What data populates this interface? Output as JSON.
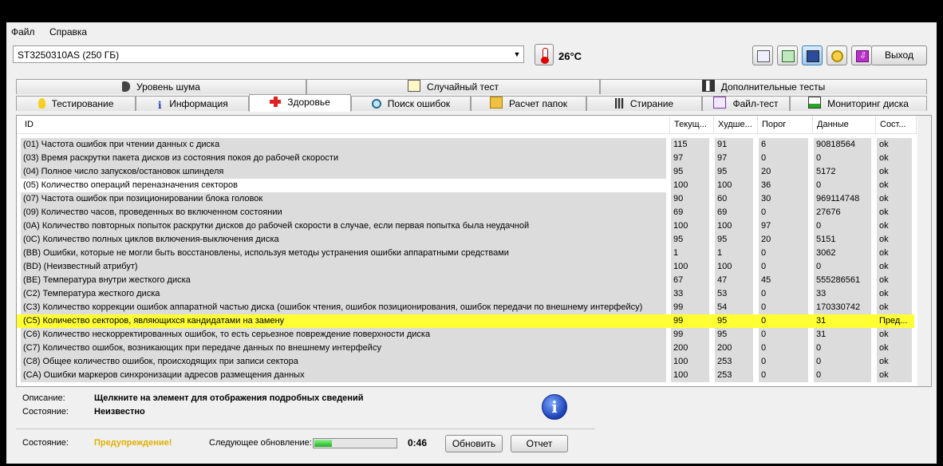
{
  "menu": {
    "file": "Файл",
    "help": "Справка"
  },
  "drive": {
    "selected": "ST3250310AS (250 ГБ)",
    "temperature": "26°C"
  },
  "toolbar": {
    "exit_label": "Выход"
  },
  "tabs_row1": [
    {
      "label": "Уровень шума",
      "icon": "speaker-icon"
    },
    {
      "label": "Случайный тест",
      "icon": "dice-icon"
    },
    {
      "label": "Дополнительные тесты",
      "icon": "chart-icon"
    }
  ],
  "tabs_row2": [
    {
      "label": "Тестирование",
      "icon": "bulb-icon"
    },
    {
      "label": "Информация",
      "icon": "info-icon"
    },
    {
      "label": "Здоровье",
      "icon": "red-cross-icon"
    },
    {
      "label": "Поиск ошибок",
      "icon": "magnifier-icon"
    },
    {
      "label": "Расчет папок",
      "icon": "folder-icon"
    },
    {
      "label": "Стирание",
      "icon": "trash-icon"
    },
    {
      "label": "Файл-тест",
      "icon": "file-test-icon"
    },
    {
      "label": "Мониторинг диска",
      "icon": "monitor-chart-icon"
    }
  ],
  "table": {
    "headers": [
      "ID",
      "Текущ...",
      "Худше...",
      "Порог",
      "Данные",
      "Сост..."
    ],
    "rows": [
      [
        "(01) Частота ошибок при чтении данных с диска",
        "115",
        "91",
        "6",
        "90818564",
        "ok"
      ],
      [
        "(03) Время раскрутки пакета дисков из состояния покоя до рабочей скорости",
        "97",
        "97",
        "0",
        "0",
        "ok"
      ],
      [
        "(04) Полное число запусков/остановок шпинделя",
        "95",
        "95",
        "20",
        "5172",
        "ok"
      ],
      [
        "(05) Количество операций переназначения секторов",
        "100",
        "100",
        "36",
        "0",
        "ok"
      ],
      [
        "(07) Частота ошибок при позиционировании блока головок",
        "90",
        "60",
        "30",
        "969114748",
        "ok"
      ],
      [
        "(09) Количество часов, проведенных во включенном состоянии",
        "69",
        "69",
        "0",
        "27676",
        "ok"
      ],
      [
        "(0A) Количество повторных попыток раскрутки дисков до рабочей скорости в случае, если первая попытка была неудачной",
        "100",
        "100",
        "97",
        "0",
        "ok"
      ],
      [
        "(0C) Количество полных циклов включения-выключения диска",
        "95",
        "95",
        "20",
        "5151",
        "ok"
      ],
      [
        "(BB) Ошибки, которые не могли быть восстановлены, используя методы устранения ошибки аппаратными средствами",
        "1",
        "1",
        "0",
        "3062",
        "ok"
      ],
      [
        "(BD) (Неизвестный атрибут)",
        "100",
        "100",
        "0",
        "0",
        "ok"
      ],
      [
        "(BE) Температура внутри жесткого диска",
        "67",
        "47",
        "45",
        "555286561",
        "ok"
      ],
      [
        "(C2) Температура жесткого диска",
        "33",
        "53",
        "0",
        "33",
        "ok"
      ],
      [
        "(C3) Количество коррекции ошибок аппаратной частью диска (ошибок чтения, ошибок позиционирования, ошибок передачи по внешнему интерфейсу)",
        "99",
        "54",
        "0",
        "170330742",
        "ok"
      ],
      [
        "(C5) Количество секторов, являющихся кандидатами на замену",
        "99",
        "95",
        "0",
        "31",
        "Пред..."
      ],
      [
        "(C6) Количество нескорректированных ошибок, то есть серьезное повреждение поверхности диска",
        "99",
        "95",
        "0",
        "31",
        "ok"
      ],
      [
        "(C7) Количество ошибок, возникающих при передаче данных по внешнему интерфейсу",
        "200",
        "200",
        "0",
        "0",
        "ok"
      ],
      [
        "(C8) Общее количество ошибок, происходящих при записи сектора",
        "100",
        "253",
        "0",
        "0",
        "ok"
      ],
      [
        "(CA)  Ошибки маркеров синхронизации адресов размещения данных",
        "100",
        "253",
        "0",
        "0",
        "ok"
      ]
    ],
    "highlight_row": 13,
    "highlight_color": "#ffff33"
  },
  "details": {
    "description_label": "Описание:",
    "description_value": "Щелкните на элемент для отображения подробных сведений",
    "state_label": "Состояние:",
    "state_value": "Неизвестно"
  },
  "status": {
    "label": "Состояние:",
    "value": "Предупреждение!",
    "value_color": "#e0b000",
    "next_update_label": "Следующее обновление:",
    "progress_fraction": 0.22,
    "timer": "0:46",
    "refresh_label": "Обновить",
    "report_label": "Отчет"
  }
}
